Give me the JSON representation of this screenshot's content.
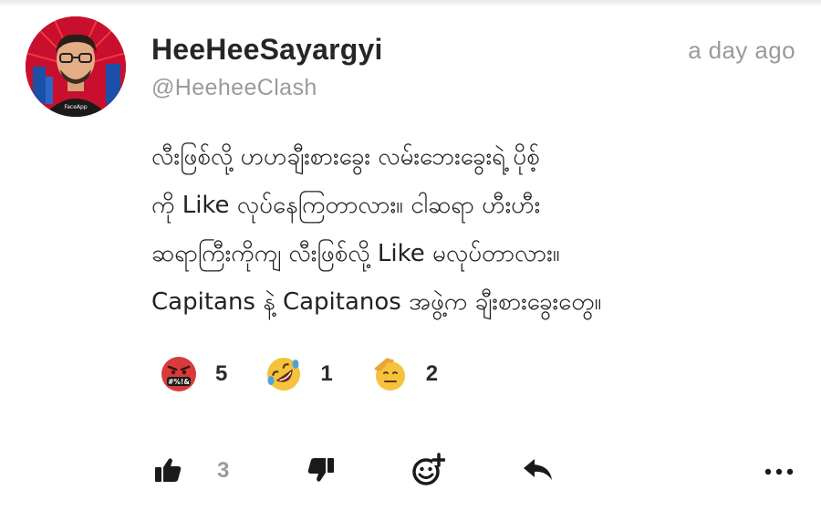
{
  "comment": {
    "author_name": "HeeHeeSayargyi",
    "author_handle": "@HeeheeClash",
    "timestamp": "a day ago",
    "body": "လီးဖြစ်လို့ ဟဟချီးစားခွေး လမ်းဘေးခွေးရဲ့ ပိုစ့်\nကို Like လုပ်နေကြတာလား။ ငါဆရာ ဟီးဟီး\nဆရာကြီးကိုကျ လီးဖြစ်လို့ Like မလုပ်တာလား။\nCapitans နဲ့ Capitanos အဖွဲ့က ချီးစားခွေးတွေ။",
    "avatar_badge": "FaceApp"
  },
  "reactions": [
    {
      "icon": "cursing-face-icon",
      "symbols": "#%!&",
      "count": "5"
    },
    {
      "icon": "rolling-laughing-face-icon",
      "count": "1"
    },
    {
      "icon": "saluting-face-icon",
      "count": "2"
    }
  ],
  "actions": {
    "like_count": "3",
    "like_icon": "thumbs-up-icon",
    "dislike_icon": "thumbs-down-icon",
    "add_reaction_icon": "add-reaction-icon",
    "reply_icon": "reply-icon",
    "more_icon": "more-icon"
  },
  "colors": {
    "text": "#222222",
    "muted": "#9a9a9a",
    "avatar_bg": "#c8102e",
    "emoji_red": "#d93a3a",
    "emoji_yellow": "#f5c33b"
  }
}
